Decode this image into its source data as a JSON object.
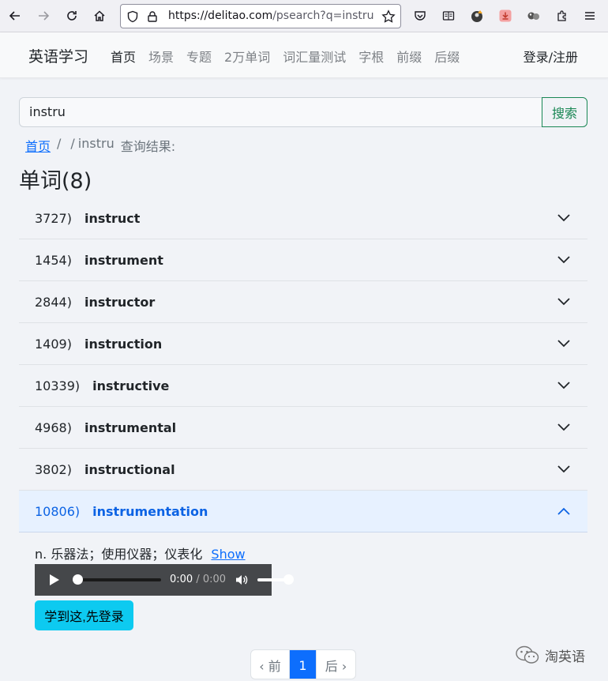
{
  "browser": {
    "url_host": "https://delitao.com",
    "url_rest": "/psearch?q=instru"
  },
  "site": {
    "brand": "英语学习",
    "nav": [
      "首页",
      "场景",
      "专题",
      "2万单词",
      "词汇量测试",
      "字根",
      "前缀",
      "后缀"
    ],
    "login": "登录/注册"
  },
  "search": {
    "value": "instru",
    "button": "搜索"
  },
  "breadcrumb": {
    "home": "首页",
    "sep1": "/",
    "sep2": "/",
    "query": "instru",
    "suffix": "查询结果:"
  },
  "section_title": "单词(8)",
  "words": [
    {
      "num": "3727)",
      "word": "instruct"
    },
    {
      "num": "1454)",
      "word": "instrument"
    },
    {
      "num": "2844)",
      "word": "instructor"
    },
    {
      "num": "1409)",
      "word": "instruction"
    },
    {
      "num": "10339)",
      "word": "instructive"
    },
    {
      "num": "4968)",
      "word": "instrumental"
    },
    {
      "num": "3802)",
      "word": "instructional"
    },
    {
      "num": "10806)",
      "word": "instrumentation"
    }
  ],
  "expanded": {
    "definition": "n. 乐器法；使用仪器；仪表化",
    "show_link": "Show",
    "audio_time": "0:00",
    "audio_sep": " / ",
    "audio_duration": "0:00",
    "learn_button": "学到这,先登录"
  },
  "pagination": {
    "prev": "‹ 前",
    "current": "1",
    "next": "后 ›"
  },
  "watermark": "淘英语",
  "colors": {
    "primary": "#0d6efd",
    "success": "#198754",
    "info": "#0dcaf0",
    "accordion_open_bg": "#e7f1ff"
  }
}
